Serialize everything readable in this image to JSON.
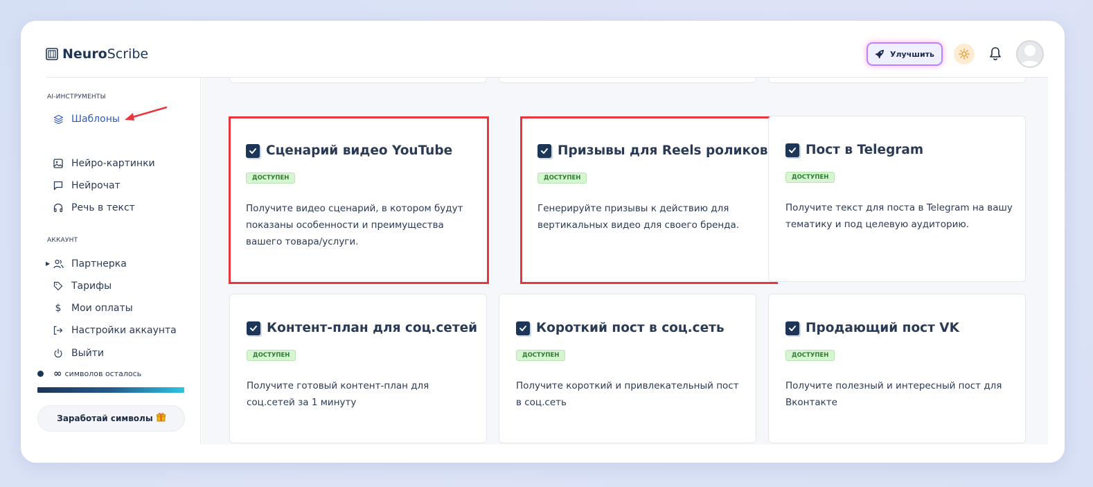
{
  "header": {
    "logo_bold": "Neuro",
    "logo_light": "Scribe",
    "upgrade_label": "Улучшить",
    "icons": [
      "rocket-icon",
      "sun-icon",
      "bell-icon",
      "avatar"
    ]
  },
  "sidebar": {
    "ai_section": "AI-ИНСТРУМЕНТЫ",
    "ai_items": [
      {
        "label": "Шаблоны",
        "icon": "layers-icon",
        "active": true
      },
      {
        "label": "Нейро-картинки",
        "icon": "image-icon"
      },
      {
        "label": "Нейрочат",
        "icon": "chat-icon"
      },
      {
        "label": "Речь в текст",
        "icon": "headphones-icon"
      }
    ],
    "account_section": "АККАУНТ",
    "account_items": [
      {
        "label": "Партнерка",
        "icon": "users-icon"
      },
      {
        "label": "Тарифы",
        "icon": "tag-icon"
      },
      {
        "label": "Мои оплаты",
        "icon": "dollar-icon"
      },
      {
        "label": "Настройки аккаунта",
        "icon": "logout-arrow-icon"
      },
      {
        "label": "Выйти",
        "icon": "power-icon"
      }
    ],
    "chars_symbol": "∞",
    "chars_text": "символов осталось",
    "earn_label": "Заработай символы"
  },
  "cards": [
    {
      "title": "Сценарий видео YouTube",
      "badge": "ДОСТУПЕН",
      "desc": "Получите видео сценарий, в котором будут показаны особенности и преимущества вашего товара/услуги.",
      "highlight": true
    },
    {
      "title": "Призывы для Reels роликов",
      "badge": "ДОСТУПЕН",
      "desc": "Генерируйте призывы к действию для вертикальных видео для своего бренда.",
      "highlight": true
    },
    {
      "title": "Пост в Telegram",
      "badge": "ДОСТУПЕН",
      "desc": "Получите текст для поста в Telegram на вашу тематику и под целевую аудиторию."
    },
    {
      "title": "Контент-план для соц.сетей",
      "badge": "ДОСТУПЕН",
      "desc": "Получите готовый контент-план для соц.сетей за 1 минуту"
    },
    {
      "title": "Короткий пост в соц.сеть",
      "badge": "ДОСТУПЕН",
      "desc": "Получите короткий и привлекательный пост в соц.сеть"
    },
    {
      "title": "Продающий пост VK",
      "badge": "ДОСТУПЕН",
      "desc": "Получите полезный и интересный пост для Вконтакте"
    }
  ],
  "colors": {
    "accent": "#2f5bb7",
    "highlight": "#e8363e",
    "badge_bg": "#d7f5d3",
    "badge_text": "#2e7d32",
    "brand": "#1d3557"
  }
}
